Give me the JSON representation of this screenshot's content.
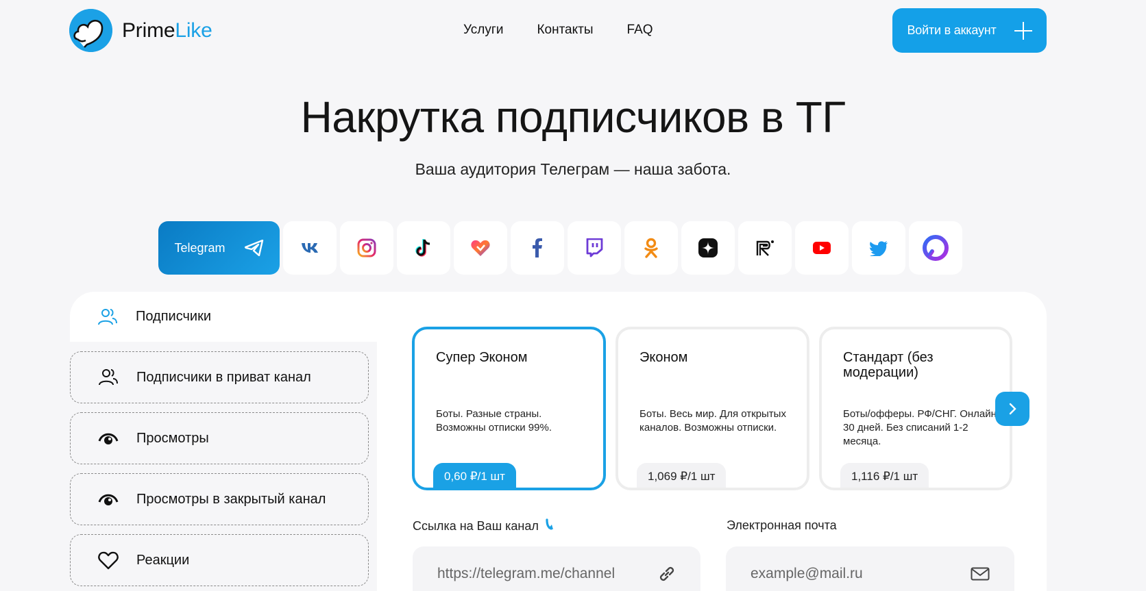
{
  "brand": {
    "name_part1": "Prime",
    "name_part2": "Like",
    "accent_color": "#1ba1e6"
  },
  "nav": {
    "items": [
      "Услуги",
      "Контакты",
      "FAQ"
    ]
  },
  "header": {
    "login_label": "Войти в аккаунт"
  },
  "hero": {
    "title": "Накрутка подписчиков в ТГ",
    "subtitle": "Ваша аудитория Телеграм — наша забота."
  },
  "platforms": {
    "active_label": "Telegram",
    "icons": [
      "telegram-icon",
      "vk-icon",
      "instagram-icon",
      "tiktok-icon",
      "likee-icon",
      "facebook-icon",
      "twitch-icon",
      "odnoklassniki-icon",
      "dzen-icon",
      "rutube-icon",
      "youtube-icon",
      "twitter-icon",
      "threads-icon"
    ]
  },
  "services": {
    "active": "Подписчики",
    "items": [
      "Подписчики в приват канал",
      "Просмотры",
      "Просмотры в закрытый канал",
      "Реакции"
    ]
  },
  "tariffs": [
    {
      "name": "Супер Эконом",
      "desc": "Боты. Разные страны. Возможны отписки 99%.",
      "price": "0,60 ₽/1 шт",
      "selected": true
    },
    {
      "name": "Эконом",
      "desc": "Боты. Весь мир. Для открытых каналов. Возможны отписки.",
      "price": "1,069 ₽/1 шт",
      "selected": false
    },
    {
      "name": "Стандарт (без модерации)",
      "desc": "Боты/офферы. РФ/СНГ. Онлайн 30 дней. Без списаний 1-2 месяца.",
      "price": "1,116 ₽/1 шт",
      "selected": false
    }
  ],
  "form": {
    "link_label": "Ссылка на Ваш канал",
    "link_placeholder": "https://telegram.me/channel",
    "email_label": "Электронная почта",
    "email_placeholder": "example@mail.ru"
  }
}
